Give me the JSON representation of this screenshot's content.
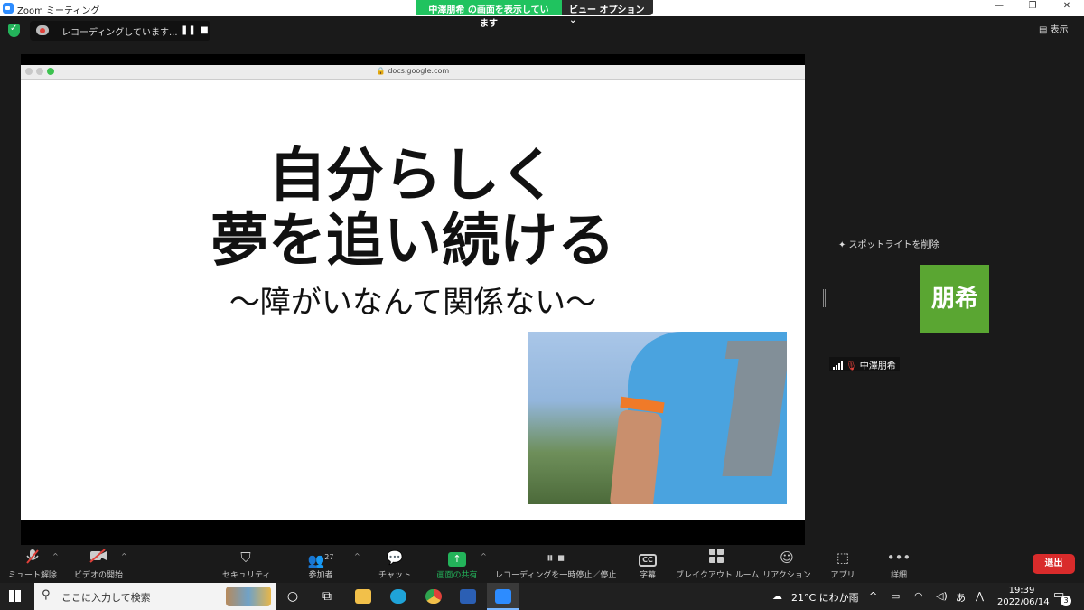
{
  "window": {
    "title": "Zoom ミーティング",
    "share_banner": "中澤朋希 の画面を表示しています",
    "view_options": "ビュー オプション ⌄",
    "controls": {
      "minimize": "—",
      "restore": "❐",
      "close": "✕"
    }
  },
  "recording": {
    "text": "レコーディングしています...",
    "pause": "❚❚",
    "stop": "■"
  },
  "display_button": "▤ 表示",
  "shared": {
    "url": "🔒 docs.google.com",
    "slide": {
      "title_line1": "自分らしく",
      "title_line2": "夢を追い続ける",
      "subtitle": "〜障がいなんて関係ない〜"
    }
  },
  "participant": {
    "spotlight": "✦ スポットライトを削除",
    "avatar_text": "朋希",
    "name": "中澤朋希"
  },
  "toolbar": {
    "items": [
      {
        "label": "ミュート解除",
        "icon": "mic-muted-icon"
      },
      {
        "label": "ビデオの開始",
        "icon": "video-off-icon"
      },
      {
        "label": "セキュリティ",
        "icon": "shield-icon"
      },
      {
        "label": "参加者",
        "icon": "people-icon",
        "count": "27"
      },
      {
        "label": "チャット",
        "icon": "chat-icon"
      },
      {
        "label": "画面の共有",
        "icon": "share-icon"
      },
      {
        "label": "レコーディングを一時停止／停止",
        "icon": "record-icon"
      },
      {
        "label": "字幕",
        "icon": "cc-icon",
        "glyph": "CC"
      },
      {
        "label": "ブレイクアウト ルーム",
        "icon": "grid-icon"
      },
      {
        "label": "リアクション",
        "icon": "smile-icon"
      },
      {
        "label": "アプリ",
        "icon": "apps-icon"
      },
      {
        "label": "詳細",
        "icon": "more-icon"
      }
    ],
    "leave": "退出"
  },
  "taskbar": {
    "search_placeholder": "ここに入力して検索",
    "weather": "21°C にわか雨",
    "ime": "あ",
    "time": "19:39",
    "date": "2022/06/14",
    "notifications": "3"
  },
  "colors": {
    "zoom_blue": "#2d8cff",
    "share_green": "#23b35a",
    "leave_red": "#d92b2b",
    "avatar_green": "#5aa632"
  }
}
